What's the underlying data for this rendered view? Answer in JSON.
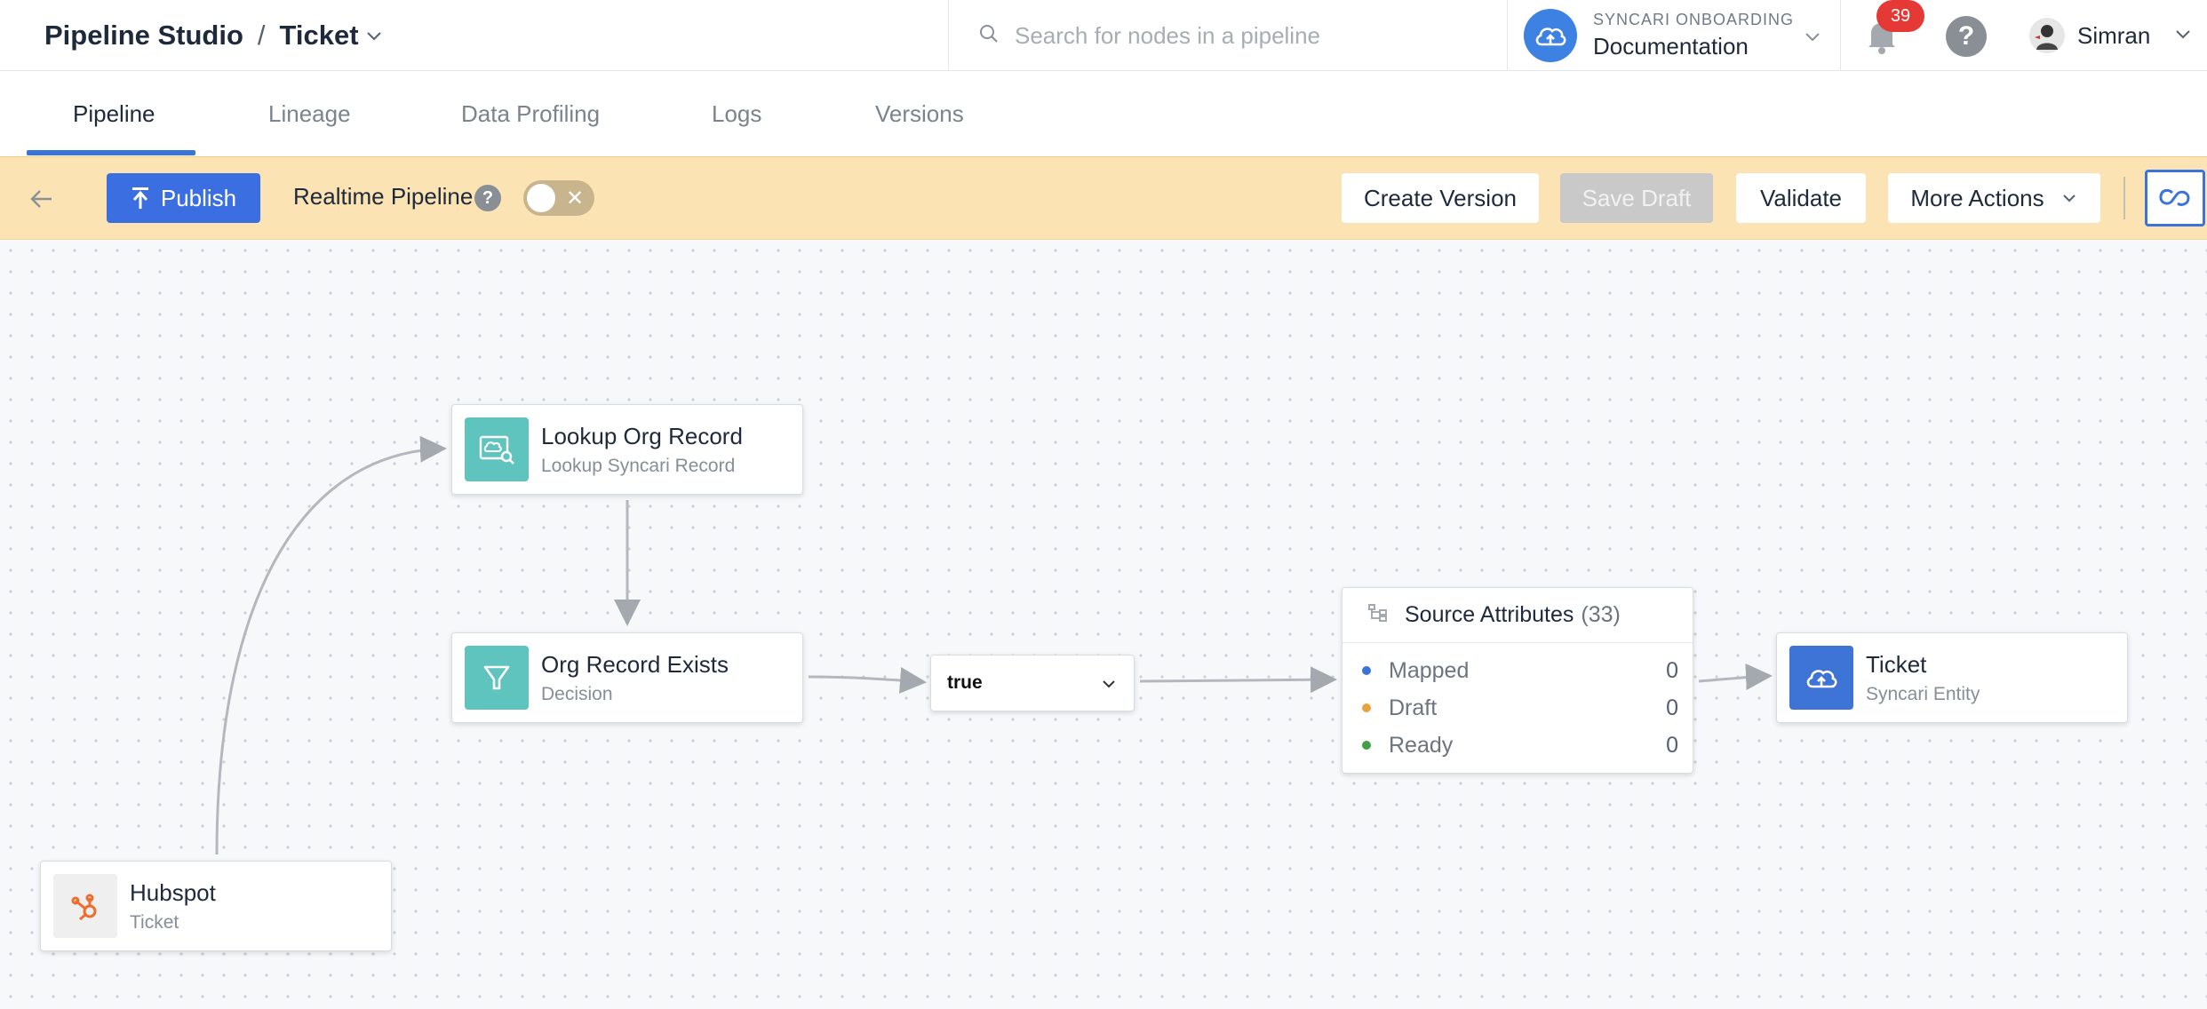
{
  "header": {
    "breadcrumb_root": "Pipeline Studio",
    "breadcrumb_separator": "/",
    "breadcrumb_current": "Ticket",
    "search_placeholder": "Search for nodes in a pipeline",
    "org_name": "SYNCARI ONBOARDING",
    "org_space": "Documentation",
    "notification_count": "39",
    "help_label": "?",
    "user_name": "Simran"
  },
  "tabs": [
    {
      "label": "Pipeline",
      "active": true
    },
    {
      "label": "Lineage",
      "active": false
    },
    {
      "label": "Data Profiling",
      "active": false
    },
    {
      "label": "Logs",
      "active": false
    },
    {
      "label": "Versions",
      "active": false
    }
  ],
  "toolbar": {
    "publish_label": "Publish",
    "realtime_label": "Realtime Pipeline",
    "realtime_help": "?",
    "realtime_enabled": false,
    "toggle_off_glyph": "✕",
    "create_version_label": "Create Version",
    "save_draft_label": "Save Draft",
    "validate_label": "Validate",
    "more_actions_label": "More Actions"
  },
  "canvas": {
    "nodes": {
      "lookup": {
        "title": "Lookup Org Record",
        "subtitle": "Lookup Syncari Record",
        "icon": "lookup-record-icon"
      },
      "decision": {
        "title": "Org Record Exists",
        "subtitle": "Decision",
        "icon": "filter-funnel-icon"
      },
      "hubspot": {
        "title": "Hubspot",
        "subtitle": "Ticket",
        "icon": "hubspot-logo-icon"
      },
      "ticket": {
        "title": "Ticket",
        "subtitle": "Syncari Entity",
        "icon": "cloud-entity-icon"
      }
    },
    "branch_dropdown": {
      "value": "true"
    },
    "source_attributes": {
      "title": "Source Attributes",
      "count": "(33)",
      "rows": [
        {
          "label": "Mapped",
          "value": "0",
          "color": "#3b74d9"
        },
        {
          "label": "Draft",
          "value": "0",
          "color": "#e8a33d"
        },
        {
          "label": "Ready",
          "value": "0",
          "color": "#43a047"
        }
      ]
    }
  },
  "colors": {
    "accent": "#3b6ee0",
    "toolbar_bg": "#fbe3b3",
    "teal_node": "#5ec4bd",
    "entity_node": "#3d74d6",
    "badge": "#e53935"
  }
}
